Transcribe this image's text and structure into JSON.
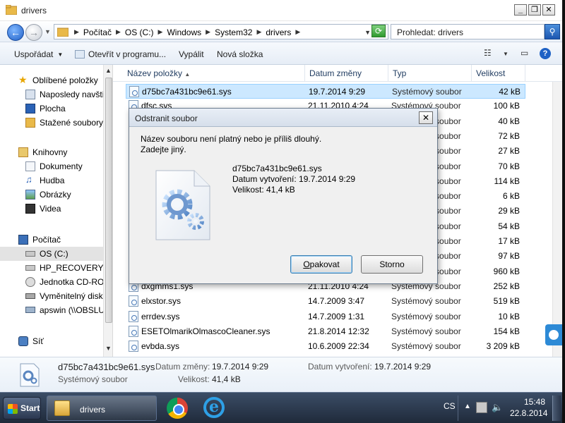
{
  "window": {
    "title": "drivers"
  },
  "address": {
    "crumbs": [
      "Počítač",
      "OS (C:)",
      "Windows",
      "System32",
      "drivers"
    ],
    "search_placeholder": "Prohledat: drivers"
  },
  "toolbar": {
    "organize": "Uspořádat",
    "open_with": "Otevřít v programu...",
    "burn": "Vypálit",
    "new_folder": "Nová složka"
  },
  "nav": {
    "favorites_header": "Oblíbené položky",
    "favorites": [
      "Naposledy navšti",
      "Plocha",
      "Stažené soubory"
    ],
    "libraries_header": "Knihovny",
    "libraries": [
      "Dokumenty",
      "Hudba",
      "Obrázky",
      "Videa"
    ],
    "computer_header": "Počítač",
    "drives": [
      "OS (C:)",
      "HP_RECOVERY (D",
      "Jednotka CD-ROI",
      "Vyměnitelný disk",
      "apswin (\\\\OBSLU"
    ],
    "network": "Síť"
  },
  "columns": {
    "name": "Název položky",
    "date": "Datum změny",
    "type": "Typ",
    "size": "Velikost"
  },
  "files": [
    {
      "name": "d75bc7a431bc9e61.sys",
      "date": "19.7.2014 9:29",
      "type": "Systémový soubor",
      "size": "42 kB"
    },
    {
      "name": "dfsc.sys",
      "date": "21.11.2010 4:24",
      "type": "Systémový soubor",
      "size": "100 kB"
    },
    {
      "name": "",
      "date": "",
      "type": "Systémový soubor",
      "size": "40 kB"
    },
    {
      "name": "",
      "date": "",
      "type": "Systémový soubor",
      "size": "72 kB"
    },
    {
      "name": "",
      "date": "",
      "type": "Systémový soubor",
      "size": "27 kB"
    },
    {
      "name": "",
      "date": "",
      "type": "Systémový soubor",
      "size": "70 kB"
    },
    {
      "name": "",
      "date": "",
      "type": "Systémový soubor",
      "size": "114 kB"
    },
    {
      "name": "",
      "date": "",
      "type": "Systémový soubor",
      "size": "6 kB"
    },
    {
      "name": "",
      "date": "",
      "type": "Systémový soubor",
      "size": "29 kB"
    },
    {
      "name": "",
      "date": "",
      "type": "Systémový soubor",
      "size": "54 kB"
    },
    {
      "name": "",
      "date": "",
      "type": "Systémový soubor",
      "size": "17 kB"
    },
    {
      "name": "",
      "date": "",
      "type": "Systémový soubor",
      "size": "97 kB"
    },
    {
      "name": "",
      "date": "",
      "type": "Systémový soubor",
      "size": "960 kB"
    },
    {
      "name": "dxgmms1.sys",
      "date": "21.11.2010 4:24",
      "type": "Systémový soubor",
      "size": "252 kB"
    },
    {
      "name": "elxstor.sys",
      "date": "14.7.2009 3:47",
      "type": "Systémový soubor",
      "size": "519 kB"
    },
    {
      "name": "errdev.sys",
      "date": "14.7.2009 1:31",
      "type": "Systémový soubor",
      "size": "10 kB"
    },
    {
      "name": "ESETOlmarikOlmascoCleaner.sys",
      "date": "21.8.2014 12:32",
      "type": "Systémový soubor",
      "size": "154 kB"
    },
    {
      "name": "evbda.sys",
      "date": "10.6.2009 22:34",
      "type": "Systémový soubor",
      "size": "3 209 kB"
    }
  ],
  "details": {
    "name": "d75bc7a431bc9e61.sys",
    "modified_label": "Datum změny:",
    "modified": "19.7.2014 9:29",
    "created_label": "Datum vytvoření:",
    "created": "19.7.2014 9:29",
    "type": "Systémový soubor",
    "size_label": "Velikost:",
    "size": "41,4 kB"
  },
  "dialog": {
    "title": "Odstranit soubor",
    "message_1": "Název souboru není platný nebo je příliš dlouhý.",
    "message_2": "Zadejte jiný.",
    "file_name": "d75bc7a431bc9e61.sys",
    "created_line": "Datum vytvoření: 19.7.2014 9:29",
    "size_line": "Velikost: 41,4 kB",
    "retry_prefix": "",
    "retry_accel": "O",
    "retry_rest": "pakovat",
    "cancel": "Storno"
  },
  "taskbar": {
    "start": "Start",
    "task_label": "drivers",
    "lang": "CS",
    "time": "15:48",
    "date": "22.8.2014"
  },
  "colors": {
    "selection": "#cce8ff",
    "accent": "#1f62c5"
  }
}
